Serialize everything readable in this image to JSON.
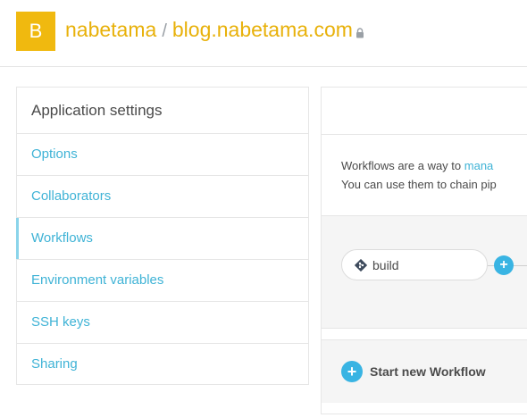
{
  "header": {
    "avatar_letter": "B",
    "owner": "nabetama",
    "separator": "/",
    "app_name": "blog.nabetama.com"
  },
  "sidebar": {
    "title": "Application settings",
    "items": [
      {
        "label": "Options"
      },
      {
        "label": "Collaborators"
      },
      {
        "label": "Workflows",
        "active": true
      },
      {
        "label": "Environment variables"
      },
      {
        "label": "SSH keys"
      },
      {
        "label": "Sharing"
      }
    ]
  },
  "main": {
    "description_line1_prefix": "Workflows are a way to ",
    "description_line1_link": "mana",
    "description_line2": "You can use them to chain pip",
    "workflow_step": "build",
    "new_workflow_label": "Start new Workflow"
  },
  "colors": {
    "accent": "#e8b10a",
    "link": "#3fb3d6",
    "button": "#39b4e3"
  }
}
